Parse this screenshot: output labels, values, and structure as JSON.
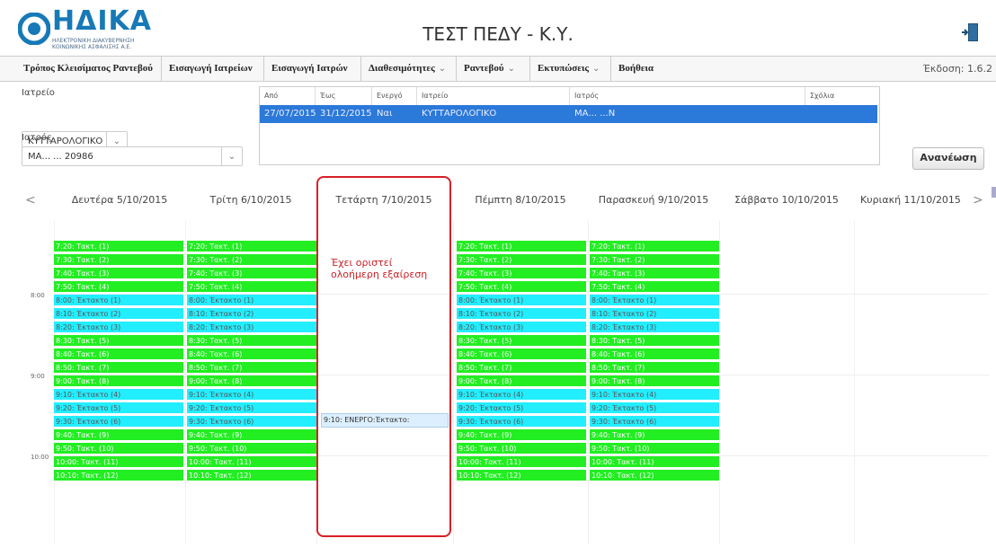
{
  "header": {
    "logo_text": "ΗΔΙΚΑ",
    "logo_sub1": "ΗΛΕΚΤΡΟΝΙΚΗ ΔΙΑΚΥΒΕΡΝΗΣΗ",
    "logo_sub2": "ΚΟΙΝΩΝΙΚΗΣ ΑΣΦΑΛΙΣΗΣ Α.Ε.",
    "title": "ΤΕΣΤ ΠΕΔΥ - Κ.Υ.",
    "exit_icon": "exit-door-icon"
  },
  "menu": {
    "items": [
      {
        "label": "Τρόπος Κλεισίματος Ραντεβού",
        "caret": false
      },
      {
        "label": "Εισαγωγή Ιατρείων",
        "caret": false
      },
      {
        "label": "Εισαγωγή Ιατρών",
        "caret": false
      },
      {
        "label": "Διαθεσιμότητες",
        "caret": true
      },
      {
        "label": "Ραντεβού",
        "caret": true
      },
      {
        "label": "Εκτυπώσεις",
        "caret": true
      },
      {
        "label": "Βοήθεια",
        "caret": false
      }
    ],
    "caret_glyph": "⌄",
    "version": "Έκδοση: 1.6.2"
  },
  "filters": {
    "clinic_label": "Ιατρείο",
    "clinic_value": "ΚΥΤΤΑΡΟΛΟΓΙΚΟ",
    "doctor_label": "Ιατρός",
    "doctor_value": "ΜΑ... ... 20986",
    "dropdown_glyph": "⌄"
  },
  "exceptions_grid": {
    "headers": [
      "Από",
      "Έως",
      "Ενεργό",
      "Ιατρείο",
      "Ιατρός",
      "Σχόλια"
    ],
    "row": [
      "27/07/2015",
      "31/12/2015",
      "Ναι",
      "ΚΥΤΤΑΡΟΛΟΓΙΚΟ",
      "ΜΑ... ...Ν",
      ""
    ]
  },
  "refresh_label": "Ανανέωση",
  "calendar": {
    "prev": "<",
    "next": ">",
    "days": [
      "Δευτέρα 5/10/2015",
      "Τρίτη 6/10/2015",
      "Τετάρτη 7/10/2015",
      "Πέμπτη 8/10/2015",
      "Παρασκευή 9/10/2015",
      "Σάββατο 10/10/2015",
      "Κυριακή 11/10/2015"
    ],
    "hours": [
      "8:00",
      "9:00",
      "10:00"
    ],
    "slots": [
      {
        "time": "7:20",
        "label": "Τακτ. (1)",
        "kind": "t"
      },
      {
        "time": "7:30",
        "label": "Τακτ. (2)",
        "kind": "t"
      },
      {
        "time": "7:40",
        "label": "Τακτ. (3)",
        "kind": "t"
      },
      {
        "time": "7:50",
        "label": "Τακτ. (4)",
        "kind": "t"
      },
      {
        "time": "8:00",
        "label": "Έκτακτο (1)",
        "kind": "e"
      },
      {
        "time": "8:10",
        "label": "Έκτακτο (2)",
        "kind": "e"
      },
      {
        "time": "8:20",
        "label": "Έκτακτο (3)",
        "kind": "e"
      },
      {
        "time": "8:30",
        "label": "Τακτ. (5)",
        "kind": "t"
      },
      {
        "time": "8:40",
        "label": "Τακτ. (6)",
        "kind": "t"
      },
      {
        "time": "8:50",
        "label": "Τακτ. (7)",
        "kind": "t"
      },
      {
        "time": "9:00",
        "label": "Τακτ. (8)",
        "kind": "t"
      },
      {
        "time": "9:10",
        "label": "Έκτακτο (4)",
        "kind": "e"
      },
      {
        "time": "9:20",
        "label": "Έκτακτο (5)",
        "kind": "e"
      },
      {
        "time": "9:30",
        "label": "Έκτακτο (6)",
        "kind": "e"
      },
      {
        "time": "9:40",
        "label": "Τακτ. (9)",
        "kind": "t"
      },
      {
        "time": "9:50",
        "label": "Τακτ. (10)",
        "kind": "t"
      },
      {
        "time": "10:00",
        "label": "Τακτ. (11)",
        "kind": "t"
      },
      {
        "time": "10:10",
        "label": "Τακτ. (12)",
        "kind": "t"
      }
    ],
    "slot_days": [
      0,
      1,
      3,
      4
    ],
    "exception_note": "Έχει οριστεί ολοήμερη εξαίρεση",
    "active_appointment": "9:10: ΕΝΕΡΓΟ:Έκτακτο:"
  },
  "colors": {
    "regular_slot": "#22ee22",
    "extra_slot": "#22eeff",
    "selected_row": "#2b79d9",
    "exception_border": "#d81f26"
  }
}
